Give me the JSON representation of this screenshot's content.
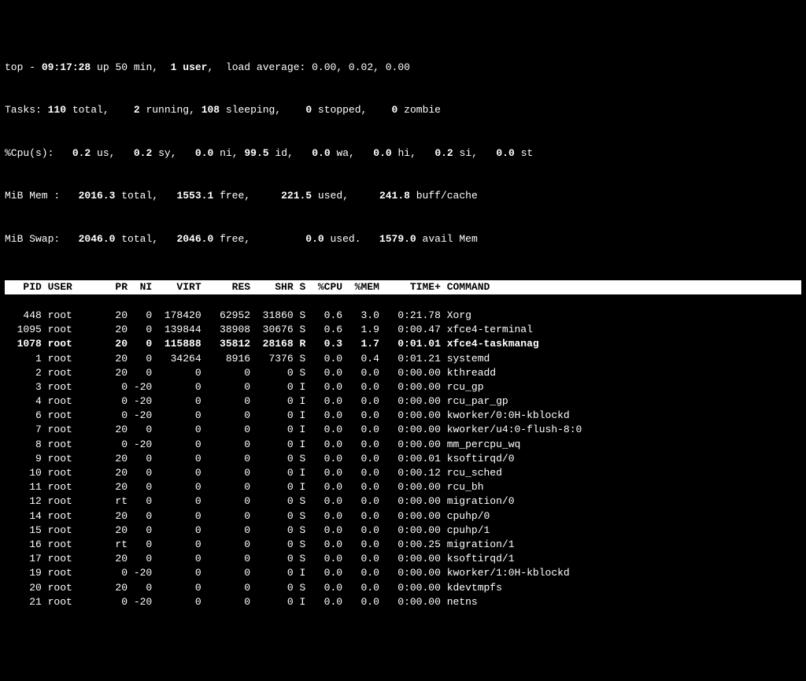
{
  "summary": {
    "line1_prefix": "top - ",
    "time": "09:17:28",
    "up_label": " up ",
    "uptime": "50 min",
    "users_sep": ",  ",
    "users": "1 user",
    "load_label": ",  load average: ",
    "load": "0.00, 0.02, 0.00",
    "tasks": {
      "label": "Tasks:",
      "total": "110",
      "total_lbl": " total,",
      "running": "2",
      "running_lbl": " running,",
      "sleeping": "108",
      "sleeping_lbl": " sleeping,",
      "stopped": "0",
      "stopped_lbl": " stopped,",
      "zombie": "0",
      "zombie_lbl": " zombie"
    },
    "cpu": {
      "label": "%Cpu(s):",
      "us": "0.2",
      "us_lbl": " us,",
      "sy": "0.2",
      "sy_lbl": " sy,",
      "ni": "0.0",
      "ni_lbl": " ni,",
      "id": "99.5",
      "id_lbl": " id,",
      "wa": "0.0",
      "wa_lbl": " wa,",
      "hi": "0.0",
      "hi_lbl": " hi,",
      "si": "0.2",
      "si_lbl": " si,",
      "st": "0.0",
      "st_lbl": " st"
    },
    "mem": {
      "label": "MiB Mem :",
      "total": "2016.3",
      "total_lbl": " total,",
      "free": "1553.1",
      "free_lbl": " free,",
      "used": "221.5",
      "used_lbl": " used,",
      "buff": "241.8",
      "buff_lbl": " buff/cache"
    },
    "swap": {
      "label": "MiB Swap:",
      "total": "2046.0",
      "total_lbl": " total,",
      "free": "2046.0",
      "free_lbl": " free,",
      "used": "0.0",
      "used_lbl": " used.",
      "avail": "1579.0",
      "avail_lbl": " avail Mem"
    }
  },
  "columns": {
    "pid": "PID",
    "user": "USER",
    "pr": "PR",
    "ni": "NI",
    "virt": "VIRT",
    "res": "RES",
    "shr": "SHR",
    "s": "S",
    "cpu": "%CPU",
    "mem": "%MEM",
    "time": "TIME+",
    "cmd": "COMMAND"
  },
  "processes": [
    {
      "pid": "448",
      "user": "root",
      "pr": "20",
      "ni": "0",
      "virt": "178420",
      "res": "62952",
      "shr": "31860",
      "s": "S",
      "cpu": "0.6",
      "mem": "3.0",
      "time": "0:21.78",
      "cmd": "Xorg",
      "hl": false
    },
    {
      "pid": "1095",
      "user": "root",
      "pr": "20",
      "ni": "0",
      "virt": "139844",
      "res": "38908",
      "shr": "30676",
      "s": "S",
      "cpu": "0.6",
      "mem": "1.9",
      "time": "0:00.47",
      "cmd": "xfce4-terminal",
      "hl": false
    },
    {
      "pid": "1078",
      "user": "root",
      "pr": "20",
      "ni": "0",
      "virt": "115888",
      "res": "35812",
      "shr": "28168",
      "s": "R",
      "cpu": "0.3",
      "mem": "1.7",
      "time": "0:01.01",
      "cmd": "xfce4-taskmanag",
      "hl": true
    },
    {
      "pid": "1",
      "user": "root",
      "pr": "20",
      "ni": "0",
      "virt": "34264",
      "res": "8916",
      "shr": "7376",
      "s": "S",
      "cpu": "0.0",
      "mem": "0.4",
      "time": "0:01.21",
      "cmd": "systemd",
      "hl": false
    },
    {
      "pid": "2",
      "user": "root",
      "pr": "20",
      "ni": "0",
      "virt": "0",
      "res": "0",
      "shr": "0",
      "s": "S",
      "cpu": "0.0",
      "mem": "0.0",
      "time": "0:00.00",
      "cmd": "kthreadd",
      "hl": false
    },
    {
      "pid": "3",
      "user": "root",
      "pr": "0",
      "ni": "-20",
      "virt": "0",
      "res": "0",
      "shr": "0",
      "s": "I",
      "cpu": "0.0",
      "mem": "0.0",
      "time": "0:00.00",
      "cmd": "rcu_gp",
      "hl": false
    },
    {
      "pid": "4",
      "user": "root",
      "pr": "0",
      "ni": "-20",
      "virt": "0",
      "res": "0",
      "shr": "0",
      "s": "I",
      "cpu": "0.0",
      "mem": "0.0",
      "time": "0:00.00",
      "cmd": "rcu_par_gp",
      "hl": false
    },
    {
      "pid": "6",
      "user": "root",
      "pr": "0",
      "ni": "-20",
      "virt": "0",
      "res": "0",
      "shr": "0",
      "s": "I",
      "cpu": "0.0",
      "mem": "0.0",
      "time": "0:00.00",
      "cmd": "kworker/0:0H-kblockd",
      "hl": false
    },
    {
      "pid": "7",
      "user": "root",
      "pr": "20",
      "ni": "0",
      "virt": "0",
      "res": "0",
      "shr": "0",
      "s": "I",
      "cpu": "0.0",
      "mem": "0.0",
      "time": "0:00.00",
      "cmd": "kworker/u4:0-flush-8:0",
      "hl": false
    },
    {
      "pid": "8",
      "user": "root",
      "pr": "0",
      "ni": "-20",
      "virt": "0",
      "res": "0",
      "shr": "0",
      "s": "I",
      "cpu": "0.0",
      "mem": "0.0",
      "time": "0:00.00",
      "cmd": "mm_percpu_wq",
      "hl": false
    },
    {
      "pid": "9",
      "user": "root",
      "pr": "20",
      "ni": "0",
      "virt": "0",
      "res": "0",
      "shr": "0",
      "s": "S",
      "cpu": "0.0",
      "mem": "0.0",
      "time": "0:00.01",
      "cmd": "ksoftirqd/0",
      "hl": false
    },
    {
      "pid": "10",
      "user": "root",
      "pr": "20",
      "ni": "0",
      "virt": "0",
      "res": "0",
      "shr": "0",
      "s": "I",
      "cpu": "0.0",
      "mem": "0.0",
      "time": "0:00.12",
      "cmd": "rcu_sched",
      "hl": false
    },
    {
      "pid": "11",
      "user": "root",
      "pr": "20",
      "ni": "0",
      "virt": "0",
      "res": "0",
      "shr": "0",
      "s": "I",
      "cpu": "0.0",
      "mem": "0.0",
      "time": "0:00.00",
      "cmd": "rcu_bh",
      "hl": false
    },
    {
      "pid": "12",
      "user": "root",
      "pr": "rt",
      "ni": "0",
      "virt": "0",
      "res": "0",
      "shr": "0",
      "s": "S",
      "cpu": "0.0",
      "mem": "0.0",
      "time": "0:00.00",
      "cmd": "migration/0",
      "hl": false
    },
    {
      "pid": "14",
      "user": "root",
      "pr": "20",
      "ni": "0",
      "virt": "0",
      "res": "0",
      "shr": "0",
      "s": "S",
      "cpu": "0.0",
      "mem": "0.0",
      "time": "0:00.00",
      "cmd": "cpuhp/0",
      "hl": false
    },
    {
      "pid": "15",
      "user": "root",
      "pr": "20",
      "ni": "0",
      "virt": "0",
      "res": "0",
      "shr": "0",
      "s": "S",
      "cpu": "0.0",
      "mem": "0.0",
      "time": "0:00.00",
      "cmd": "cpuhp/1",
      "hl": false
    },
    {
      "pid": "16",
      "user": "root",
      "pr": "rt",
      "ni": "0",
      "virt": "0",
      "res": "0",
      "shr": "0",
      "s": "S",
      "cpu": "0.0",
      "mem": "0.0",
      "time": "0:00.25",
      "cmd": "migration/1",
      "hl": false
    },
    {
      "pid": "17",
      "user": "root",
      "pr": "20",
      "ni": "0",
      "virt": "0",
      "res": "0",
      "shr": "0",
      "s": "S",
      "cpu": "0.0",
      "mem": "0.0",
      "time": "0:00.00",
      "cmd": "ksoftirqd/1",
      "hl": false
    },
    {
      "pid": "19",
      "user": "root",
      "pr": "0",
      "ni": "-20",
      "virt": "0",
      "res": "0",
      "shr": "0",
      "s": "I",
      "cpu": "0.0",
      "mem": "0.0",
      "time": "0:00.00",
      "cmd": "kworker/1:0H-kblockd",
      "hl": false
    },
    {
      "pid": "20",
      "user": "root",
      "pr": "20",
      "ni": "0",
      "virt": "0",
      "res": "0",
      "shr": "0",
      "s": "S",
      "cpu": "0.0",
      "mem": "0.0",
      "time": "0:00.00",
      "cmd": "kdevtmpfs",
      "hl": false
    },
    {
      "pid": "21",
      "user": "root",
      "pr": "0",
      "ni": "-20",
      "virt": "0",
      "res": "0",
      "shr": "0",
      "s": "I",
      "cpu": "0.0",
      "mem": "0.0",
      "time": "0:00.00",
      "cmd": "netns",
      "hl": false
    }
  ]
}
